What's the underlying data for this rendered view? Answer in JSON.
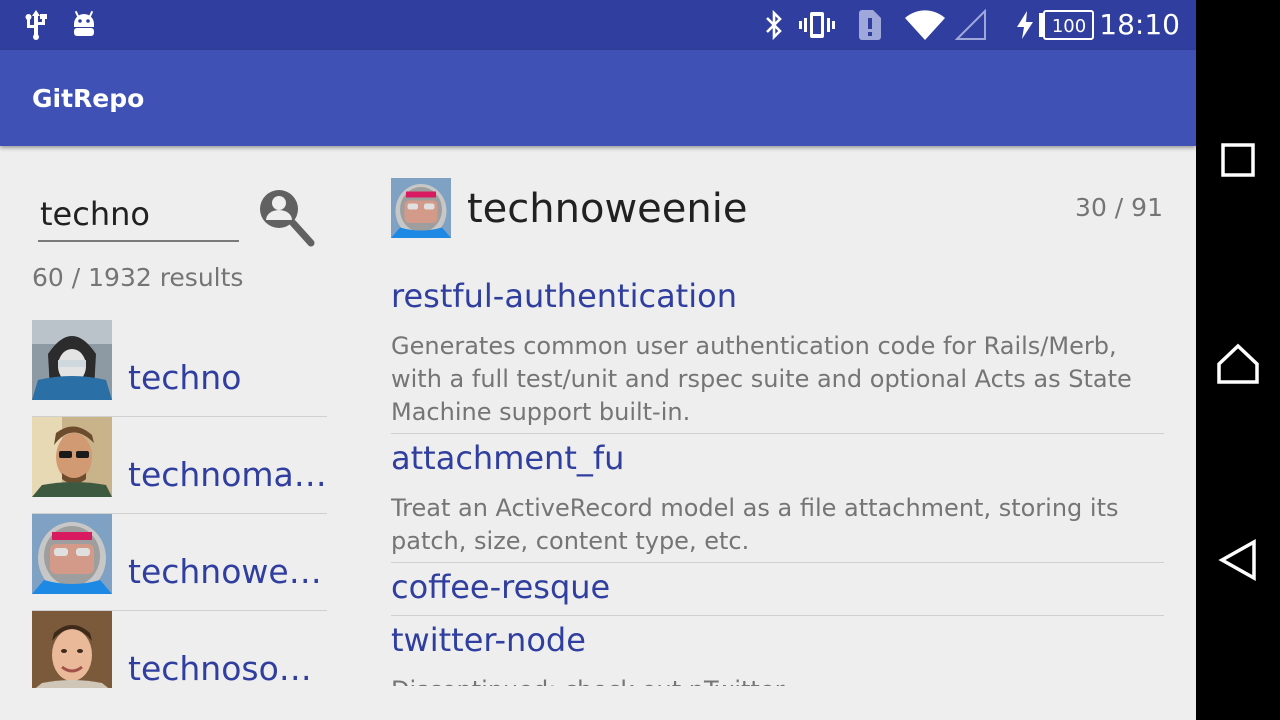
{
  "status_bar": {
    "time": "18:10",
    "battery": "100",
    "icons": [
      "usb-icon",
      "android-debug-icon",
      "bluetooth-icon",
      "vibrate-icon",
      "sim-alert-icon",
      "wifi-icon",
      "cell-signal-icon",
      "charging-icon",
      "battery-icon"
    ]
  },
  "app_bar": {
    "title": "GitRepo"
  },
  "search": {
    "query": "techno",
    "result_count": "60 / 1932 results"
  },
  "users": [
    {
      "login": "techno"
    },
    {
      "login": "technomancy"
    },
    {
      "login": "technoweenie"
    },
    {
      "login": "technosophos"
    }
  ],
  "detail": {
    "user": "technoweenie",
    "repo_count": "30 / 91",
    "repos": [
      {
        "name": "restful-authentication",
        "description": "Generates common user authentication code for Rails/Merb, with a full test/unit and rspec suite and optional Acts as State Machine support built-in."
      },
      {
        "name": "attachment_fu",
        "description": "Treat an ActiveRecord model as a file attachment, storing its patch, size, content type, etc."
      },
      {
        "name": "coffee-resque",
        "description": ""
      },
      {
        "name": "twitter-node",
        "description": "Discontinued: check out nTwitter"
      }
    ]
  },
  "colors": {
    "status_bar": "#303f9f",
    "app_bar": "#3f51b5",
    "accent_text": "#303f9f",
    "background": "#eeeeee"
  },
  "nav": {
    "icons": [
      "recents-icon",
      "home-icon",
      "back-icon"
    ]
  }
}
